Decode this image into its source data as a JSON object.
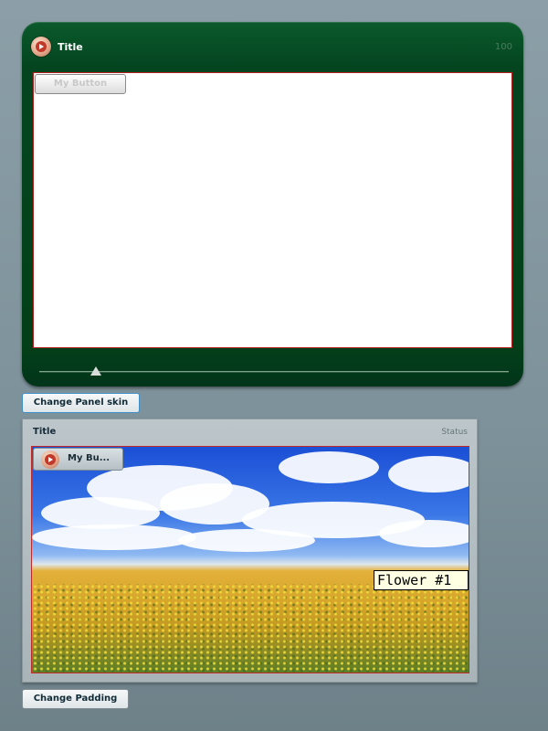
{
  "panel1": {
    "title": "Title",
    "status": "100",
    "button_label": "My Button",
    "slider_value_percent": 12,
    "icon": "play-icon"
  },
  "skin_button": {
    "label": "Change Panel skin"
  },
  "panel2": {
    "title": "Title",
    "status": "Status",
    "button_label": "My Bu...",
    "image_caption": "Flower #1",
    "icon": "play-icon"
  },
  "padding_button": {
    "label": "Change Padding"
  },
  "colors": {
    "panel1_bg": "#034019",
    "panel1_border": "#b22020",
    "panel2_bg": "#a9b4b8",
    "accent": "#3f90c8"
  }
}
